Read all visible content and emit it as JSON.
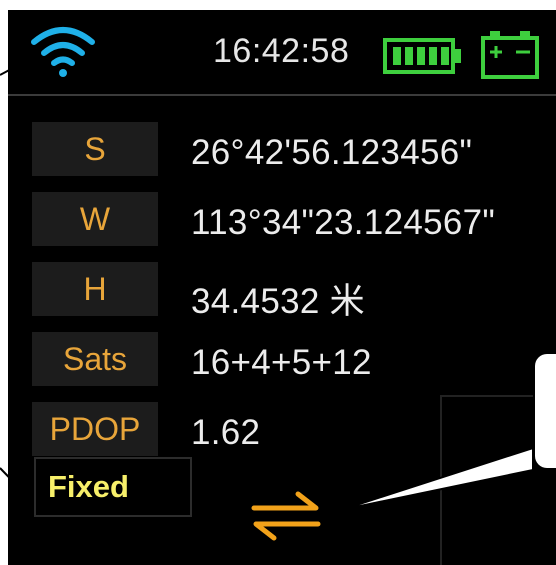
{
  "status": {
    "time": "16:42:58",
    "wifi_icon": "wifi-icon",
    "battery_icon": "battery-icon",
    "charger_icon": "external-battery-icon",
    "wifi_color": "#1fb0e8",
    "battery_color": "#3ecf3e"
  },
  "rows": [
    {
      "label": "S",
      "value": "26°42'56.123456\""
    },
    {
      "label": "W",
      "value": "113°34\"23.124567\""
    },
    {
      "label": "H",
      "value": "34.4532 米"
    },
    {
      "label": "Sats",
      "value": "16+4+5+12"
    },
    {
      "label": "PDOP",
      "value": "1.62"
    }
  ],
  "fix_status": "Fixed",
  "swap_icon": "swap-arrows-icon",
  "colors": {
    "label_text": "#e8a53a",
    "fix_text": "#f7ef6a",
    "swap": "#f2a21a"
  }
}
